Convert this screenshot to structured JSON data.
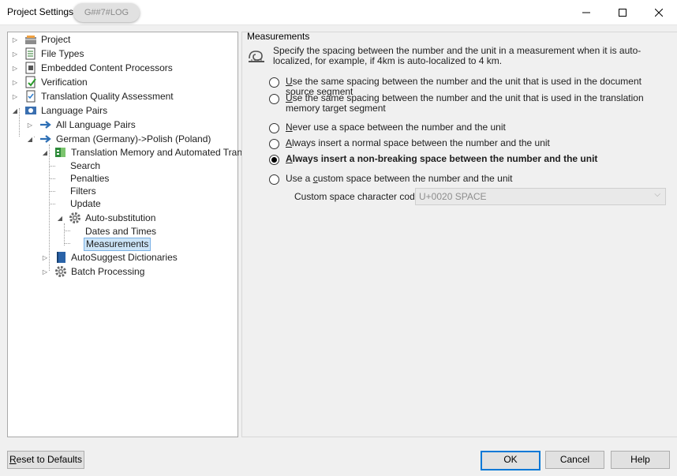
{
  "window": {
    "title": "Project Settings",
    "watermark": "G##7#LOG",
    "minimize_label": "–",
    "maximize_label": "☐",
    "close_label": "✕"
  },
  "tree": {
    "items": [
      {
        "label": "Project",
        "icon": "project-icon"
      },
      {
        "label": "File Types",
        "icon": "file-types-icon"
      },
      {
        "label": "Embedded Content Processors",
        "icon": "embedded-content-icon"
      },
      {
        "label": "Verification",
        "icon": "verification-icon"
      },
      {
        "label": "Translation Quality Assessment",
        "icon": "tqa-icon"
      },
      {
        "label": "Language Pairs",
        "icon": "language-pairs-icon"
      },
      {
        "label": "All Language Pairs",
        "icon": "arrow-right-icon"
      },
      {
        "label": "German (Germany)->Polish (Poland)",
        "icon": "arrow-right-icon"
      },
      {
        "label": "Translation Memory and Automated Tran",
        "icon": "translation-memory-icon"
      },
      {
        "label": "Search"
      },
      {
        "label": "Penalties"
      },
      {
        "label": "Filters"
      },
      {
        "label": "Update"
      },
      {
        "label": "Auto-substitution",
        "icon": "gear-icon"
      },
      {
        "label": "Dates and Times"
      },
      {
        "label": "Measurements"
      },
      {
        "label": "AutoSuggest Dictionaries",
        "icon": "book-icon"
      },
      {
        "label": "Batch Processing",
        "icon": "gear-icon"
      }
    ]
  },
  "measurements": {
    "group_title": "Measurements",
    "description": "Specify the spacing between the number and the unit in a measurement when it is auto-localized, for example, if 4km is auto-localized to 4 km.",
    "options": [
      {
        "mnemonic": "U",
        "rest": "se the same spacing between the number and the unit that is used in the document source segment",
        "selected": false
      },
      {
        "mnemonic": "U",
        "rest": "se the same spacing between the number and the unit that is used in the translation memory target segment",
        "selected": false
      },
      {
        "mnemonic": "N",
        "rest": "ever use a space between the number and the unit",
        "selected": false
      },
      {
        "mnemonic": "A",
        "rest": "lways insert a normal space between the number and the unit",
        "selected": false
      },
      {
        "mnemonic": "A",
        "rest": "lways insert a non-breaking space between the number and the unit",
        "selected": true
      },
      {
        "pre": "Use a ",
        "mnemonic": "c",
        "rest": "ustom space between the number and the unit",
        "selected": false
      }
    ],
    "custom_label": "Custom space character code:",
    "custom_value": "U+0020 SPACE"
  },
  "buttons": {
    "reset": {
      "mnemonic": "R",
      "rest": "eset to Defaults"
    },
    "ok": "OK",
    "cancel": "Cancel",
    "help": "Help"
  }
}
